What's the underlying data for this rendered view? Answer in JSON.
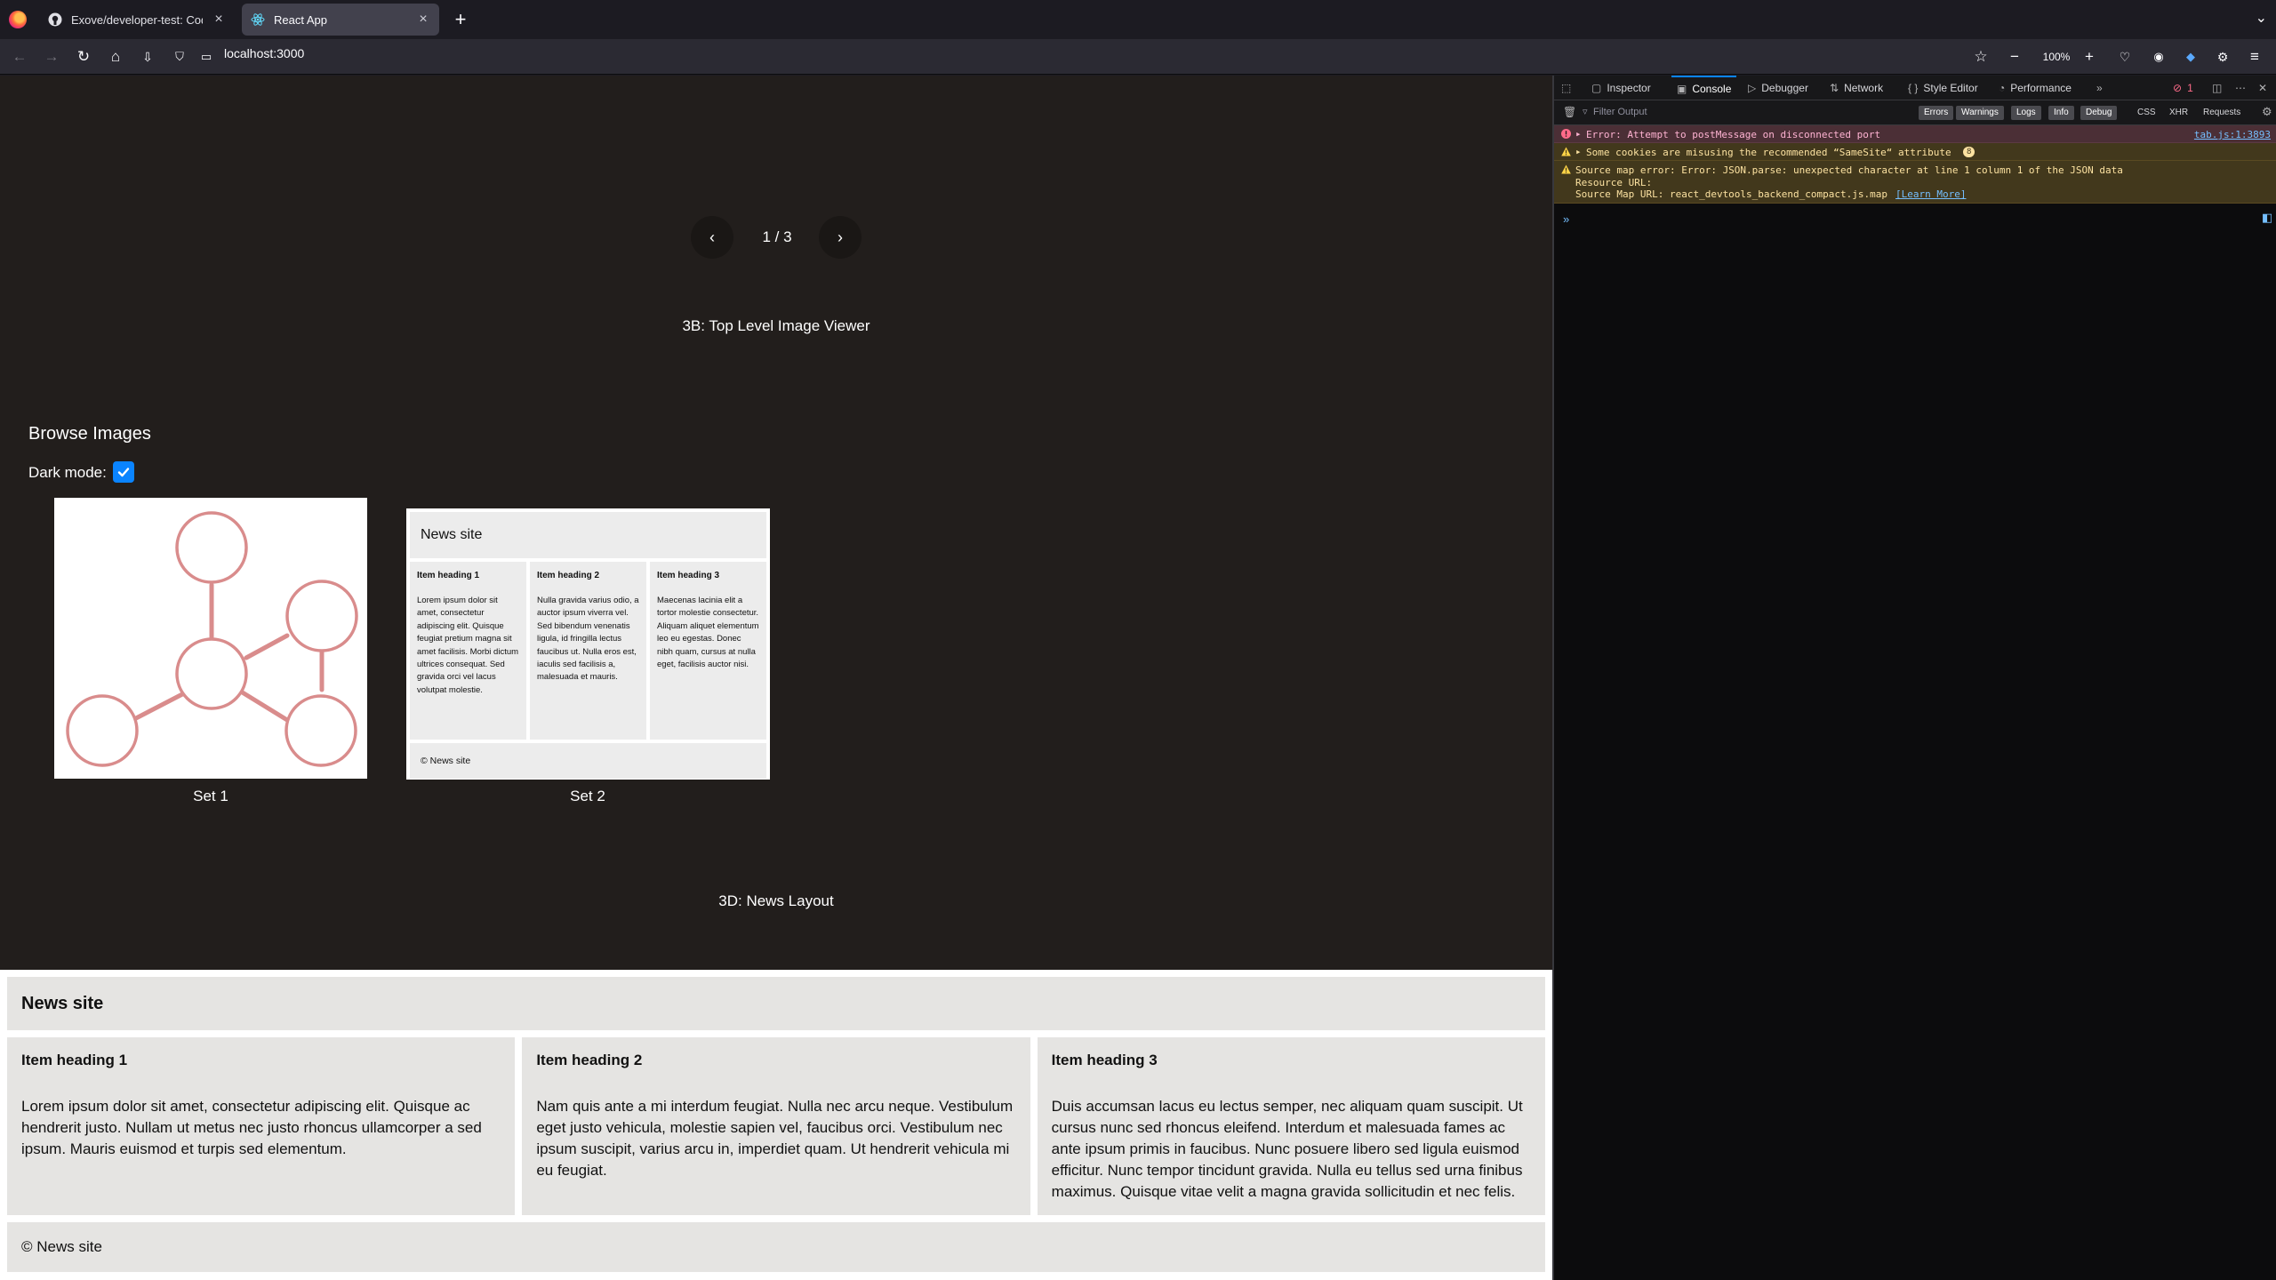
{
  "tabs": [
    {
      "title": "Exove/developer-test: Coding te",
      "favicon": "github-icon",
      "active": false
    },
    {
      "title": "React App",
      "favicon": "react-icon",
      "active": true
    }
  ],
  "nav": {
    "url": "localhost:3000",
    "zoom": "100%"
  },
  "page": {
    "pager": {
      "prev": "‹",
      "count": "1 / 3",
      "next": "›"
    },
    "caption_3b": "3B: Top Level Image Viewer",
    "browse": {
      "title": "Browse Images",
      "dark_mode_label": "Dark mode:",
      "dark_mode_checked": true,
      "sets": [
        {
          "caption": "Set 1"
        },
        {
          "caption": "Set 2"
        }
      ],
      "thumb2": {
        "header": "News site",
        "columns": [
          {
            "heading": "Item heading 1",
            "text": "Lorem ipsum dolor sit amet, consectetur adipiscing elit. Quisque feugiat pretium magna sit amet facilisis. Morbi dictum ultrices consequat. Sed gravida orci vel lacus volutpat molestie."
          },
          {
            "heading": "Item heading 2",
            "text": "Nulla gravida varius odio, a auctor ipsum viverra vel. Sed bibendum venenatis ligula, id fringilla lectus faucibus ut. Nulla eros est, iaculis sed facilisis a, malesuada et mauris."
          },
          {
            "heading": "Item heading 3",
            "text": "Maecenas lacinia elit a tortor molestie consectetur. Aliquam aliquet elementum leo eu egestas. Donec nibh quam, cursus at nulla eget, facilisis auctor nisi."
          }
        ],
        "footer": "© News site"
      }
    },
    "caption_3d": "3D: News Layout",
    "news": {
      "header": "News site",
      "columns": [
        {
          "heading": "Item heading 1",
          "text": "Lorem ipsum dolor sit amet, consectetur adipiscing elit. Quisque ac hendrerit justo. Nullam ut metus nec justo rhoncus ullamcorper a sed ipsum. Mauris euismod et turpis sed elementum."
        },
        {
          "heading": "Item heading 2",
          "text": "Nam quis ante a mi interdum feugiat. Nulla nec arcu neque. Vestibulum eget justo vehicula, molestie sapien vel, faucibus orci. Vestibulum nec ipsum suscipit, varius arcu in, imperdiet quam. Ut hendrerit vehicula mi eu feugiat."
        },
        {
          "heading": "Item heading 3",
          "text": "Duis accumsan lacus eu lectus semper, nec aliquam quam suscipit. Ut cursus nunc sed rhoncus eleifend. Interdum et malesuada fames ac ante ipsum primis in faucibus. Nunc posuere libero sed ligula euismod efficitur. Nunc tempor tincidunt gravida. Nulla eu tellus sed urna finibus maximus. Quisque vitae velit a magna gravida sollicitudin et nec felis."
        }
      ],
      "footer": "© News site"
    }
  },
  "devtools": {
    "tabs": [
      "Inspector",
      "Console",
      "Debugger",
      "Network",
      "Style Editor",
      "Performance"
    ],
    "selected_tab": "Console",
    "error_count": "1",
    "filter_placeholder": "Filter Output",
    "filters": [
      "Errors",
      "Warnings",
      "Logs",
      "Info",
      "Debug"
    ],
    "request_filters": [
      "CSS",
      "XHR",
      "Requests"
    ],
    "messages": [
      {
        "level": "error",
        "text": "Error: Attempt to postMessage on disconnected port",
        "source": "tab.js:1:3893"
      },
      {
        "level": "warning",
        "text": "Some cookies are misusing the recommended “SameSite“ attribute",
        "count": "8"
      },
      {
        "level": "warning",
        "text": "Source map error: Error: JSON.parse: unexpected character at line 1 column 1 of the JSON data",
        "line2": "Resource URL:",
        "line3": "Source Map URL: react_devtools_backend_compact.js.map",
        "learn_more": "[Learn More]"
      }
    ],
    "prompt": "»"
  },
  "colors": {
    "accent": "#0a84ff",
    "page_bg": "#221e1c",
    "molecule_stroke": "#d98c8c"
  }
}
